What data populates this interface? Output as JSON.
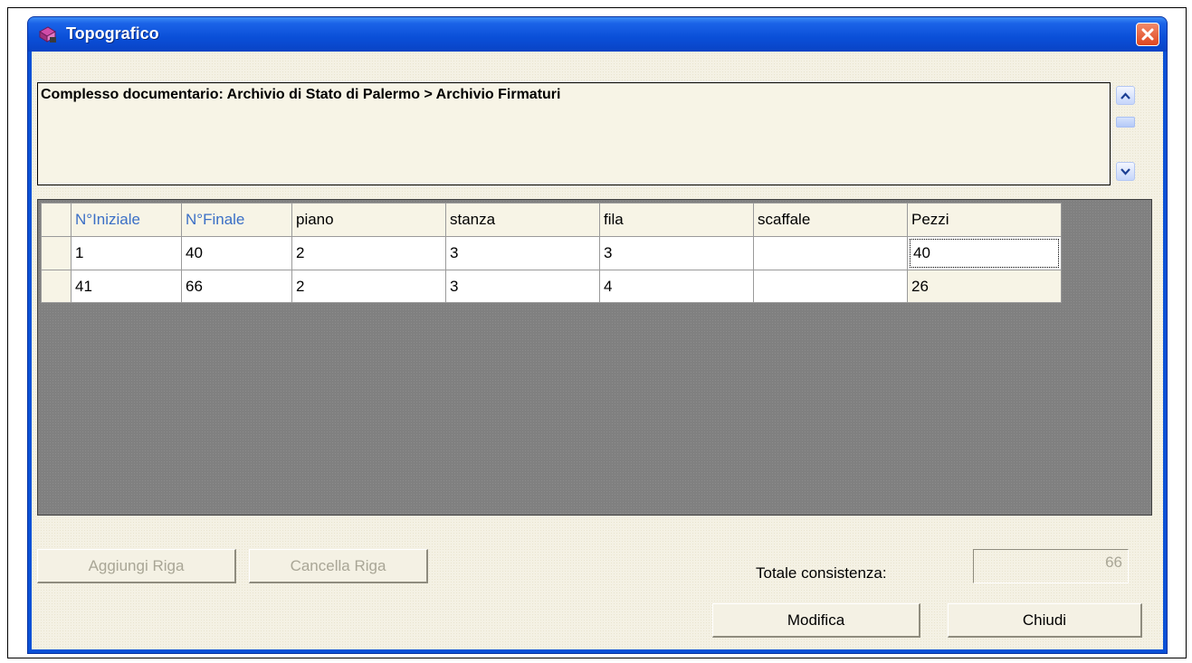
{
  "window": {
    "title": "Topografico",
    "title_color": "#ffffff",
    "titlebar_color": "#0a51d6"
  },
  "path": {
    "text": "Complesso documentario: Archivio di Stato di Palermo > Archivio Firmaturi"
  },
  "grid": {
    "headers": [
      "N°Iniziale",
      "N°Finale",
      "piano",
      "stanza",
      "fila",
      "scaffale",
      "Pezzi"
    ],
    "rows": [
      [
        "1",
        "40",
        "2",
        "3",
        "3",
        "",
        "40"
      ],
      [
        "41",
        "66",
        "2",
        "3",
        "4",
        "",
        "26"
      ]
    ],
    "header_accent": "#3b6fc6"
  },
  "buttons": {
    "add_row": "Aggiungi Riga",
    "delete_row": "Cancella Riga",
    "modify": "Modifica",
    "close": "Chiudi"
  },
  "total": {
    "label": "Totale consistenza:",
    "value": "66"
  }
}
